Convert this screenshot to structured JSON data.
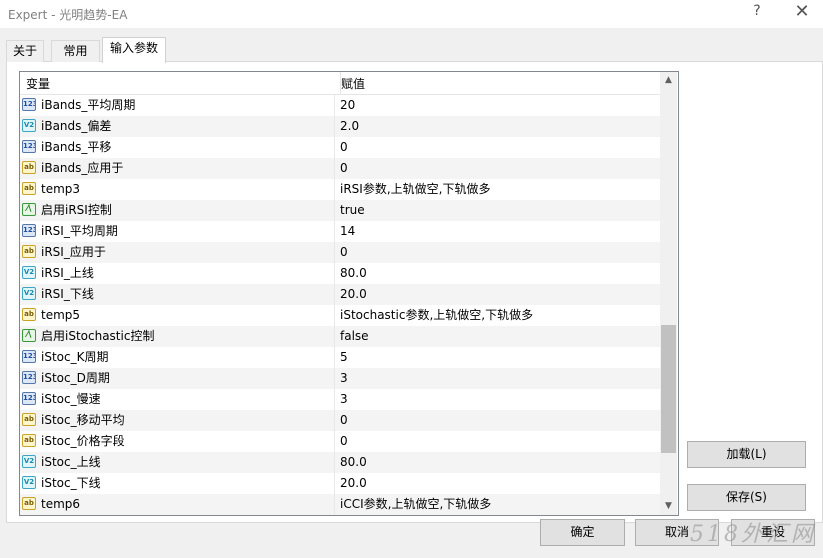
{
  "window": {
    "title": "Expert - 光明趋势-EA",
    "help_glyph": "?",
    "close_glyph": "✕"
  },
  "tabs": [
    {
      "label": "关于",
      "active": false
    },
    {
      "label": "常用",
      "active": false
    },
    {
      "label": "输入参数",
      "active": true
    }
  ],
  "table": {
    "headers": {
      "variable": "变量",
      "value": "赋值"
    },
    "rows": [
      {
        "type": "int",
        "icon_text": "123",
        "name": "iBands_平均周期",
        "value": "20"
      },
      {
        "type": "dbl",
        "icon_text": "V2",
        "name": "iBands_偏差",
        "value": "2.0"
      },
      {
        "type": "int",
        "icon_text": "123",
        "name": "iBands_平移",
        "value": "0"
      },
      {
        "type": "str",
        "icon_text": "ab",
        "name": "iBands_应用于",
        "value": "0"
      },
      {
        "type": "str",
        "icon_text": "ab",
        "name": "temp3",
        "value": "iRSI参数,上轨做空,下轨做多"
      },
      {
        "type": "bool",
        "icon_text": "⁄\\",
        "name": "启用iRSI控制",
        "value": "true"
      },
      {
        "type": "int",
        "icon_text": "123",
        "name": "iRSI_平均周期",
        "value": "14"
      },
      {
        "type": "str",
        "icon_text": "ab",
        "name": "iRSI_应用于",
        "value": "0"
      },
      {
        "type": "dbl",
        "icon_text": "V2",
        "name": "iRSI_上线",
        "value": "80.0"
      },
      {
        "type": "dbl",
        "icon_text": "V2",
        "name": "iRSI_下线",
        "value": "20.0"
      },
      {
        "type": "str",
        "icon_text": "ab",
        "name": "temp5",
        "value": "iStochastic参数,上轨做空,下轨做多"
      },
      {
        "type": "bool",
        "icon_text": "⁄\\",
        "name": "启用iStochastic控制",
        "value": "false"
      },
      {
        "type": "int",
        "icon_text": "123",
        "name": "iStoc_K周期",
        "value": "5"
      },
      {
        "type": "int",
        "icon_text": "123",
        "name": "iStoc_D周期",
        "value": "3"
      },
      {
        "type": "int",
        "icon_text": "123",
        "name": "iStoc_慢速",
        "value": "3"
      },
      {
        "type": "str",
        "icon_text": "ab",
        "name": "iStoc_移动平均",
        "value": "0"
      },
      {
        "type": "str",
        "icon_text": "ab",
        "name": "iStoc_价格字段",
        "value": "0"
      },
      {
        "type": "dbl",
        "icon_text": "V2",
        "name": "iStoc_上线",
        "value": "80.0"
      },
      {
        "type": "dbl",
        "icon_text": "V2",
        "name": "iStoc_下线",
        "value": "20.0"
      },
      {
        "type": "str",
        "icon_text": "ab",
        "name": "temp6",
        "value": "iCCI参数,上轨做空,下轨做多"
      }
    ]
  },
  "scrollbar": {
    "up_glyph": "▲",
    "down_glyph": "▼"
  },
  "buttons": {
    "load": "加载(L)",
    "save": "保存(S)",
    "ok": "确定",
    "cancel": "取消",
    "reset": "重设"
  },
  "watermark": "518外汇网"
}
